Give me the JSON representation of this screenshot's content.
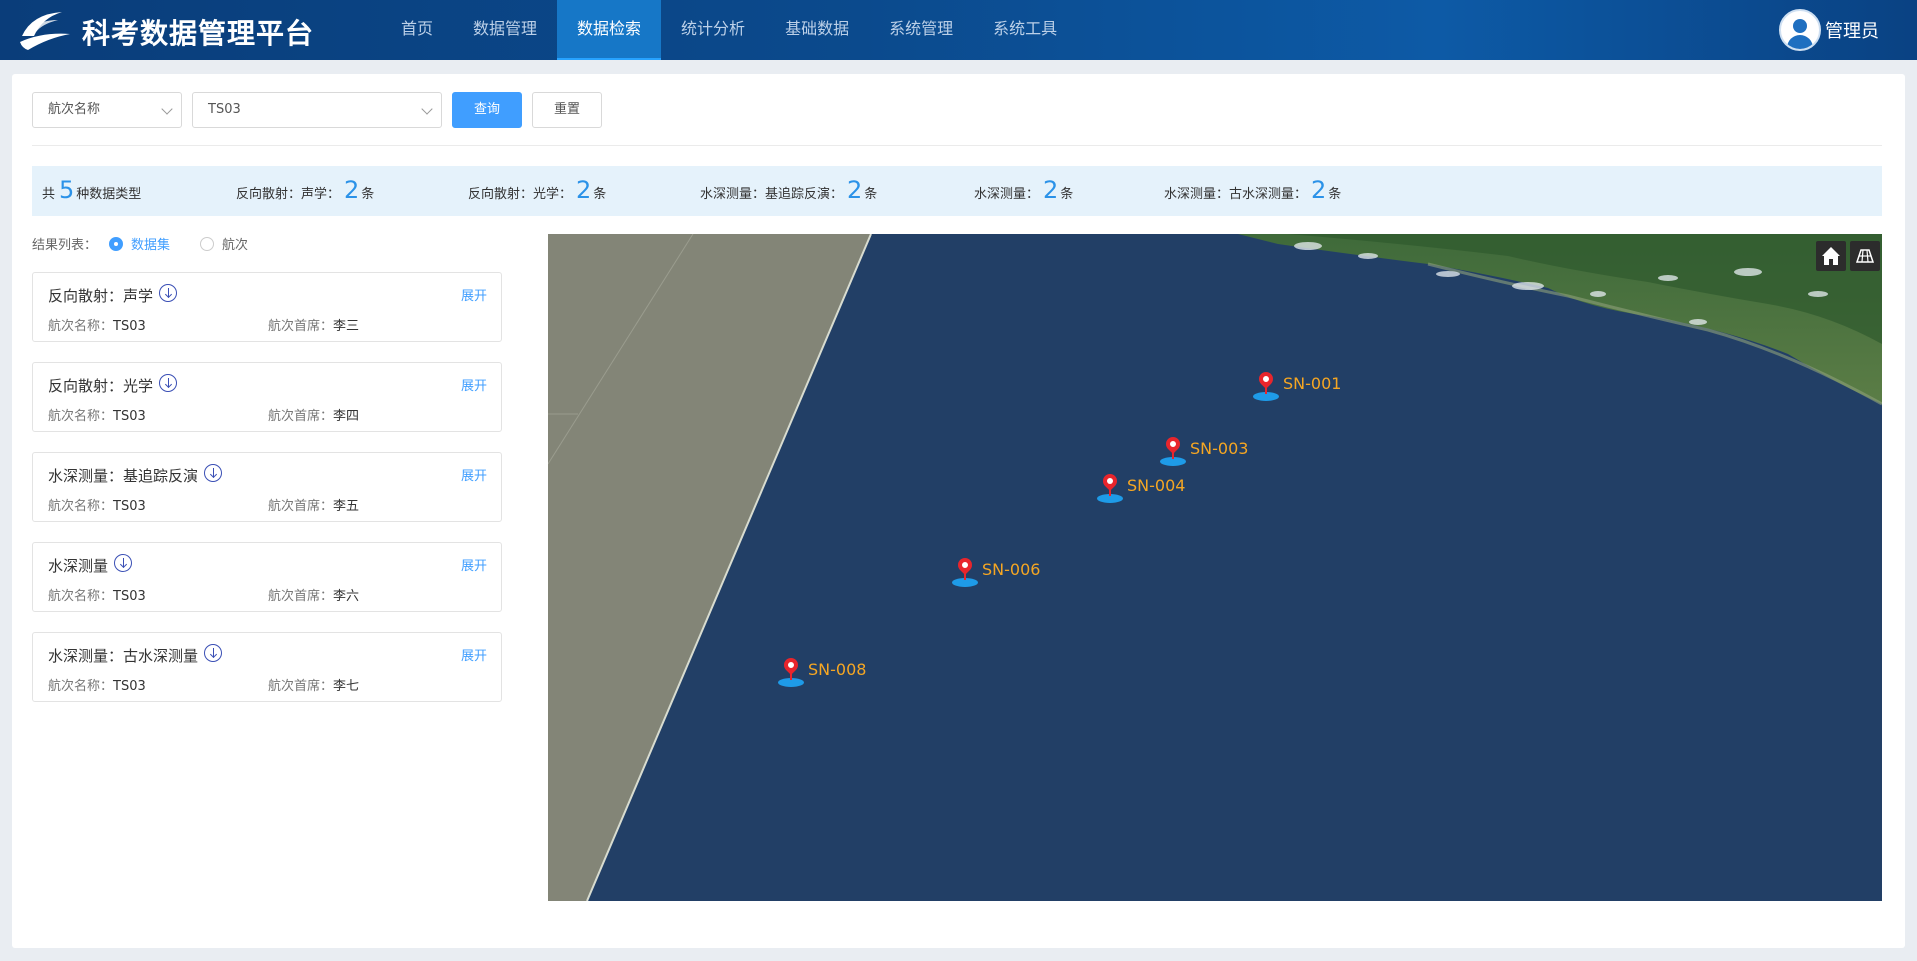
{
  "header": {
    "app_title": "科考数据管理平台",
    "nav": [
      {
        "label": "首页",
        "active": false
      },
      {
        "label": "数据管理",
        "active": false
      },
      {
        "label": "数据检索",
        "active": true
      },
      {
        "label": "统计分析",
        "active": false
      },
      {
        "label": "基础数据",
        "active": false
      },
      {
        "label": "系统管理",
        "active": false
      },
      {
        "label": "系统工具",
        "active": false
      }
    ],
    "user_name": "管理员"
  },
  "filters": {
    "field_select": "航次名称",
    "value_select": "TS03",
    "query_label": "查询",
    "reset_label": "重置"
  },
  "summary": {
    "prefix": "共",
    "total": "5",
    "suffix": "种数据类型",
    "unit": "条",
    "items": [
      {
        "label": "反向散射：声学：",
        "count": "2"
      },
      {
        "label": "反向散射：光学：",
        "count": "2"
      },
      {
        "label": "水深测量：基追踪反演：",
        "count": "2"
      },
      {
        "label": "水深测量：",
        "count": "2"
      },
      {
        "label": "水深测量：古水深测量：",
        "count": "2"
      }
    ]
  },
  "results": {
    "label": "结果列表：",
    "option_dataset": "数据集",
    "option_cruise": "航次",
    "selected": "数据集",
    "expand_label": "展开",
    "cruise_name_key": "航次名称：",
    "chief_key": "航次首席：",
    "cards": [
      {
        "title": "反向散射：声学",
        "cruise": "TS03",
        "chief": "李三"
      },
      {
        "title": "反向散射：光学",
        "cruise": "TS03",
        "chief": "李四"
      },
      {
        "title": "水深测量：基追踪反演",
        "cruise": "TS03",
        "chief": "李五"
      },
      {
        "title": "水深测量",
        "cruise": "TS03",
        "chief": "李六"
      },
      {
        "title": "水深测量：古水深测量",
        "cruise": "TS03",
        "chief": "李七"
      }
    ]
  },
  "map": {
    "home_icon": "home-icon",
    "basemap_icon": "basemap-toggle-icon",
    "markers": [
      {
        "label": "SN-001"
      },
      {
        "label": "SN-003"
      },
      {
        "label": "SN-004"
      },
      {
        "label": "SN-006"
      },
      {
        "label": "SN-008"
      }
    ]
  },
  "colors": {
    "header_bg": "#0b4a8d",
    "accent": "#409eff",
    "ocean": "#24436b",
    "land_gray": "#838577",
    "marker_pin": "#e8252c",
    "marker_label": "#f5a623"
  }
}
